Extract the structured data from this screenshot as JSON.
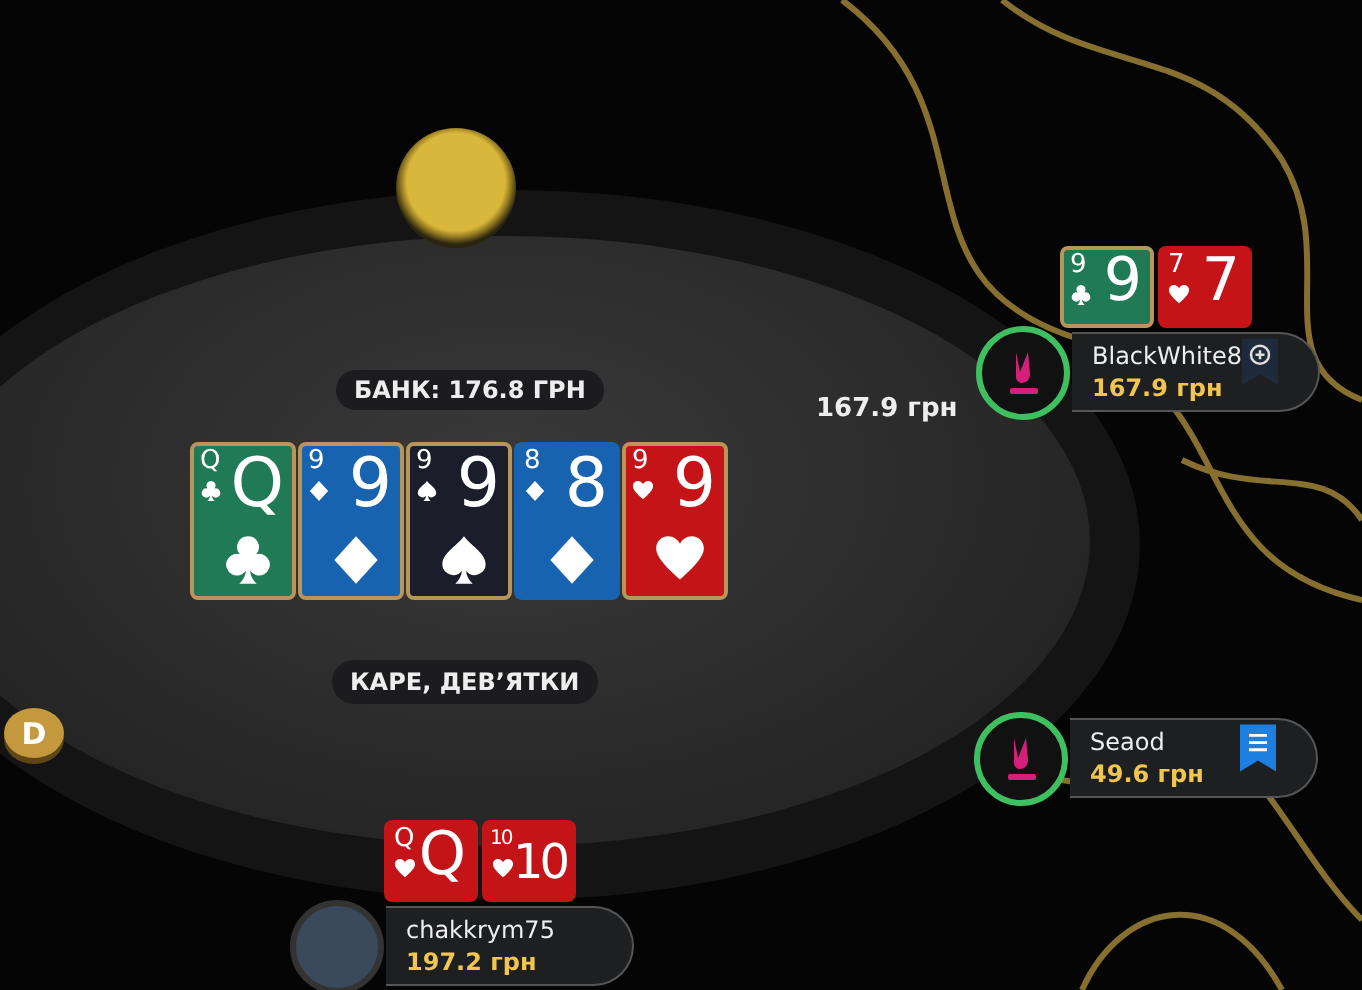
{
  "pot": {
    "label": "БАНК: 176.8 ГРН"
  },
  "board": [
    {
      "rank": "Q",
      "corner_rank": "Q",
      "kind": "clubs",
      "highlighted": true
    },
    {
      "rank": "9",
      "corner_rank": "9",
      "kind": "diamonds",
      "highlighted": true
    },
    {
      "rank": "9",
      "corner_rank": "9",
      "kind": "spades",
      "highlighted": true
    },
    {
      "rank": "8",
      "corner_rank": "8",
      "kind": "diamonds",
      "highlighted": false
    },
    {
      "rank": "9",
      "corner_rank": "9",
      "kind": "hearts",
      "highlighted": true
    }
  ],
  "hand_name": "КАРЕ, ДЕВ’ЯТКИ",
  "bet": "167.9 грн",
  "dealer_button": "D",
  "players": [
    {
      "name": "BlackWhite8",
      "stack": "167.9 грн",
      "avatar": {
        "kind": "logo"
      },
      "timer": true,
      "badge": {
        "kind": "plus"
      },
      "cards": [
        {
          "rank": "9",
          "corner_rank": "9",
          "kind": "clubs",
          "highlighted": true
        },
        {
          "rank": "7",
          "corner_rank": "7",
          "kind": "hearts",
          "highlighted": false
        }
      ]
    },
    {
      "name": "Seaod",
      "stack": "49.6 грн",
      "avatar": {
        "kind": "logo"
      },
      "timer": true,
      "badge": {
        "kind": "notes"
      }
    },
    {
      "name": "chakkrym75",
      "stack": "197.2 грн",
      "avatar": {
        "kind": "photo"
      },
      "timer": false,
      "cards": [
        {
          "rank": "Q",
          "corner_rank": "Q",
          "kind": "hearts",
          "highlighted": false
        },
        {
          "rank": "10",
          "corner_rank": "10",
          "kind": "hearts",
          "highlighted": false
        }
      ]
    }
  ]
}
